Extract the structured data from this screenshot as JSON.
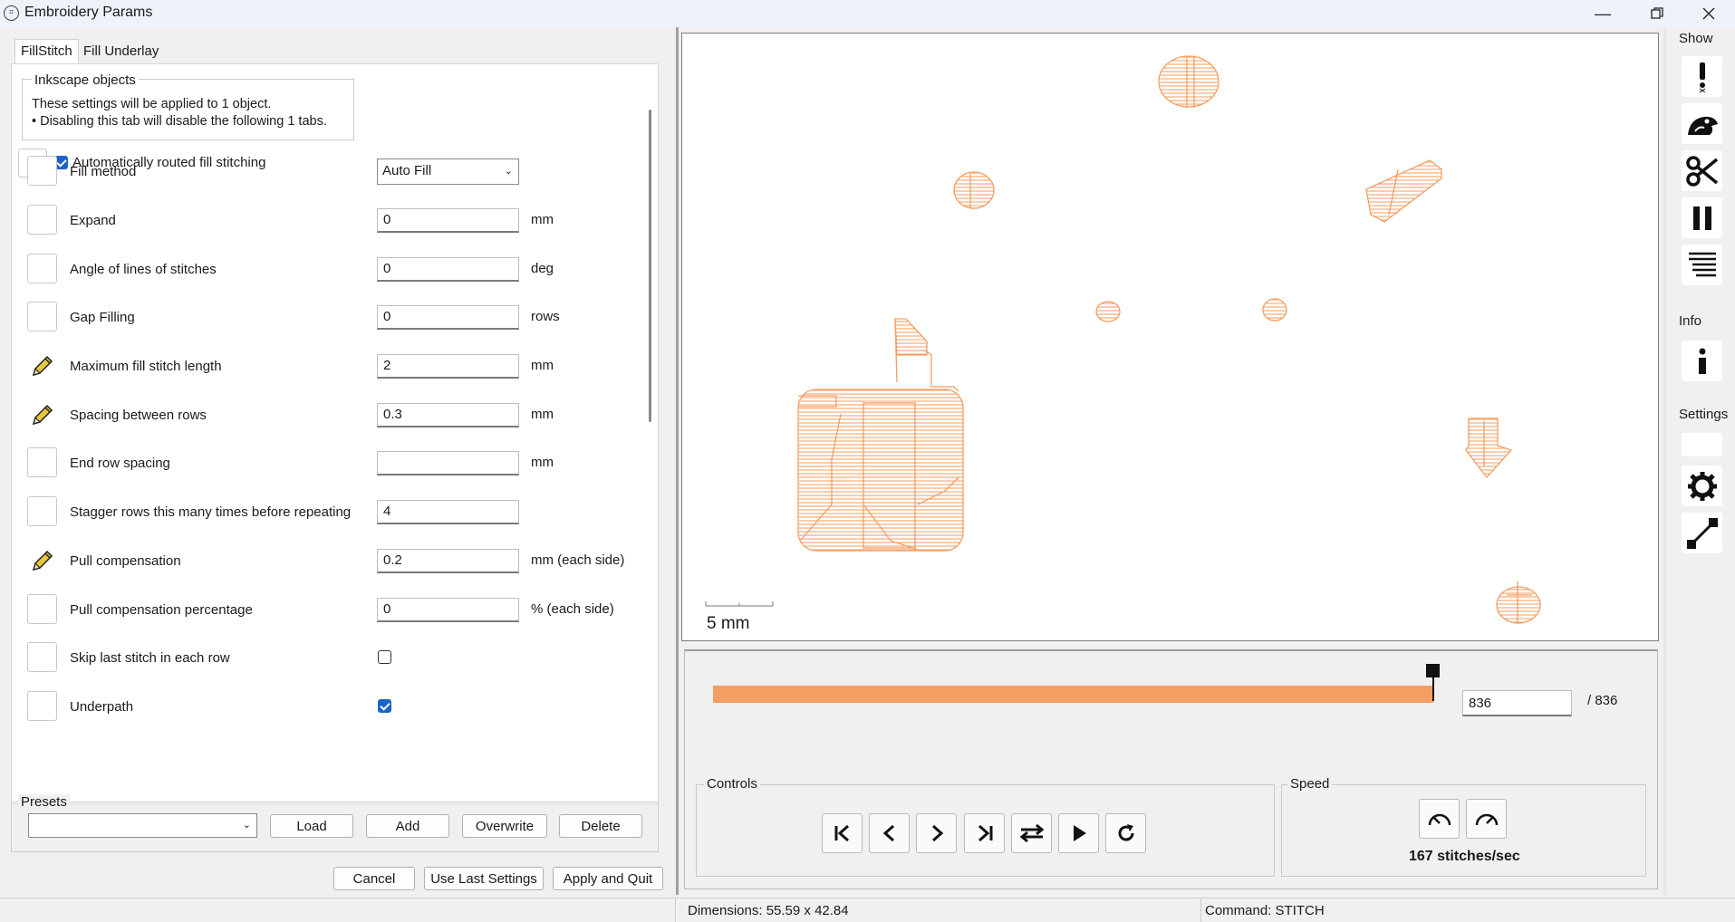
{
  "window": {
    "title": "Embroidery Params",
    "icon": "app-icon"
  },
  "tabs": [
    {
      "label": "FillStitch"
    },
    {
      "label": "Fill Underlay"
    }
  ],
  "inkscape_objects": {
    "title": "Inkscape objects",
    "lines": [
      "These settings will be applied to 1 object.",
      "• Disabling this tab will disable the following 1 tabs."
    ]
  },
  "auto_route": {
    "label": "Automatically routed fill stitching",
    "checked": true
  },
  "params": [
    {
      "label": "Fill method",
      "type": "select",
      "value": "Auto Fill",
      "unit": "",
      "edited": false
    },
    {
      "label": "Expand",
      "type": "input",
      "value": "0",
      "unit": "mm",
      "edited": false
    },
    {
      "label": "Angle of lines of stitches",
      "type": "input",
      "value": "0",
      "unit": "deg",
      "edited": false
    },
    {
      "label": "Gap Filling",
      "type": "input",
      "value": "0",
      "unit": "rows",
      "edited": false
    },
    {
      "label": "Maximum fill stitch length",
      "type": "input",
      "value": "2",
      "unit": "mm",
      "edited": true
    },
    {
      "label": "Spacing between rows",
      "type": "input",
      "value": "0.3",
      "unit": "mm",
      "edited": true
    },
    {
      "label": "End row spacing",
      "type": "input",
      "value": "",
      "unit": "mm",
      "edited": false
    },
    {
      "label": "Stagger rows this many times before repeating",
      "type": "input",
      "value": "4",
      "unit": "",
      "edited": false
    },
    {
      "label": "Pull compensation",
      "type": "input",
      "value": "0.2",
      "unit": "mm (each side)",
      "edited": true
    },
    {
      "label": "Pull compensation percentage",
      "type": "input",
      "value": "0",
      "unit": "% (each side)",
      "edited": false
    },
    {
      "label": "Skip last stitch in each row",
      "type": "checkbox",
      "checked": false,
      "edited": false
    },
    {
      "label": "Underpath",
      "type": "checkbox",
      "checked": true,
      "edited": false
    }
  ],
  "presets": {
    "title": "Presets",
    "selected": "",
    "buttons": {
      "load": "Load",
      "add": "Add",
      "overwrite": "Overwrite",
      "delete": "Delete"
    }
  },
  "footer_buttons": {
    "cancel": "Cancel",
    "use_last": "Use Last Settings",
    "apply": "Apply and Quit"
  },
  "preview": {
    "scale_label": "5 mm",
    "stitch_color": "#f39e62",
    "current_stitch": "836",
    "total_stitches": "/ 836",
    "progress_fraction": 1.0
  },
  "controls": {
    "title": "Controls",
    "buttons": [
      "skip-to-start-icon",
      "step-back-icon",
      "step-forward-icon",
      "skip-to-end-icon",
      "swap-direction-icon",
      "play-icon",
      "restart-icon"
    ]
  },
  "speed": {
    "title": "Speed",
    "value": "167 stitches/sec",
    "buttons": [
      "slower-icon",
      "faster-icon"
    ]
  },
  "sidebar": {
    "show_title": "Show",
    "show_buttons": [
      "warnings-icon",
      "needle-penetration-icon",
      "trim-icon",
      "stop-icon",
      "color-change-icon"
    ],
    "info_title": "Info",
    "info_buttons": [
      "info-icon"
    ],
    "settings_title": "Settings",
    "settings_buttons": [
      "blank-setting",
      "gear-icon",
      "resize-icon"
    ]
  },
  "status": {
    "dimensions": "Dimensions: 55.59 x 42.84",
    "command": "Command: STITCH"
  }
}
